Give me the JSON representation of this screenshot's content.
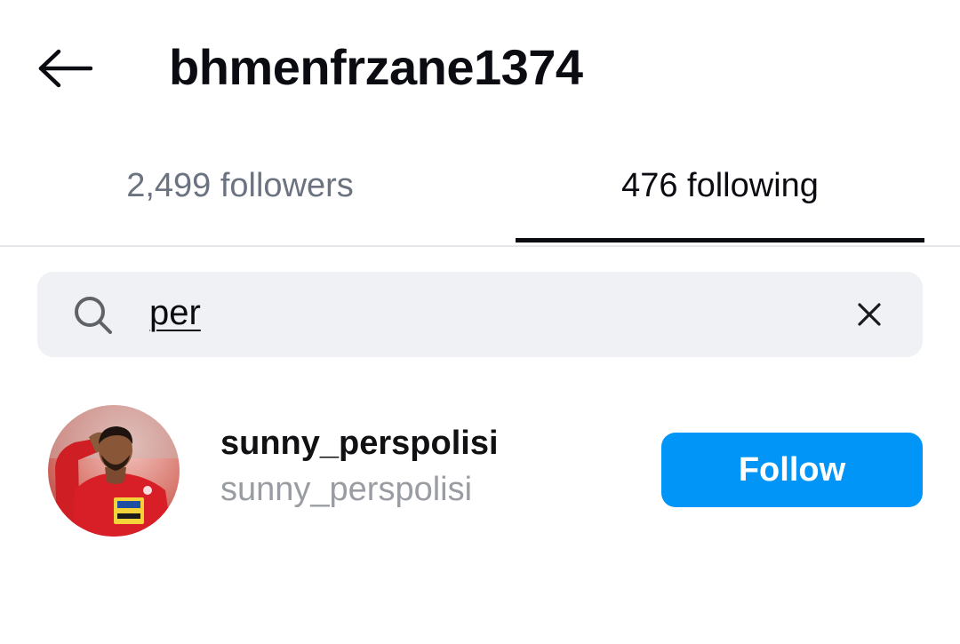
{
  "header": {
    "back_icon": "arrow-left-icon",
    "title": "bhmenfrzane1374"
  },
  "tabs": [
    {
      "label": "2,499 followers",
      "active": false
    },
    {
      "label": "476 following",
      "active": true
    }
  ],
  "search": {
    "icon": "search-icon",
    "value": "per",
    "clear_icon": "close-icon"
  },
  "results": [
    {
      "username": "sunny_perspolisi",
      "name": "sunny_perspolisi",
      "action_label": "Follow"
    }
  ],
  "colors": {
    "accent": "#0095f6",
    "active_tab": "#0b0b12",
    "inactive_tab": "#6b7280",
    "search_bg": "#eff1f4",
    "secondary_text": "#9a9ca3"
  }
}
